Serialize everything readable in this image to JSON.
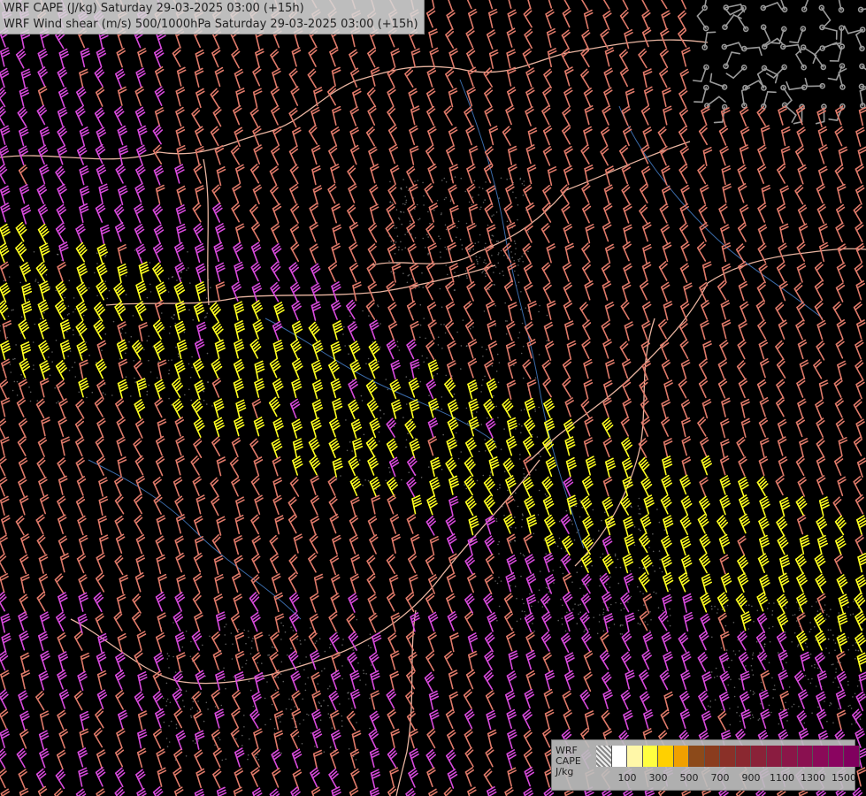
{
  "header": {
    "title_line1": "WRF CAPE (J/kg) Saturday 29-03-2025 03:00 (+15h)",
    "title_line2": "WRF Wind shear (m/s) 500/1000hPa Saturday 29-03-2025 03:00 (+15h)"
  },
  "legend": {
    "label_model": "WRF",
    "label_field": "CAPE",
    "label_unit": "J/kg",
    "swatch_colors": [
      "#b0b0b0",
      "#ffffff",
      "#fff7a8",
      "#ffff40",
      "#ffd000",
      "#f0a000",
      "#8c4a1a",
      "#8a3c1e",
      "#8a3028",
      "#8a2830",
      "#8a2238",
      "#8a1c40",
      "#8a1648",
      "#8a1050",
      "#8a0a58",
      "#8a0460",
      "#80005e"
    ],
    "tick_labels": [
      "100",
      "300",
      "500",
      "700",
      "900",
      "1100",
      "1300",
      "1500"
    ]
  },
  "barb_colors": {
    "low": "#e07a6a",
    "medium": "#d84adc",
    "high": "#ffff22",
    "calm": "#9a9a9a",
    "border": "#e8b4a0",
    "river": "#3a6aa8",
    "contour": "#bbbbbb"
  }
}
